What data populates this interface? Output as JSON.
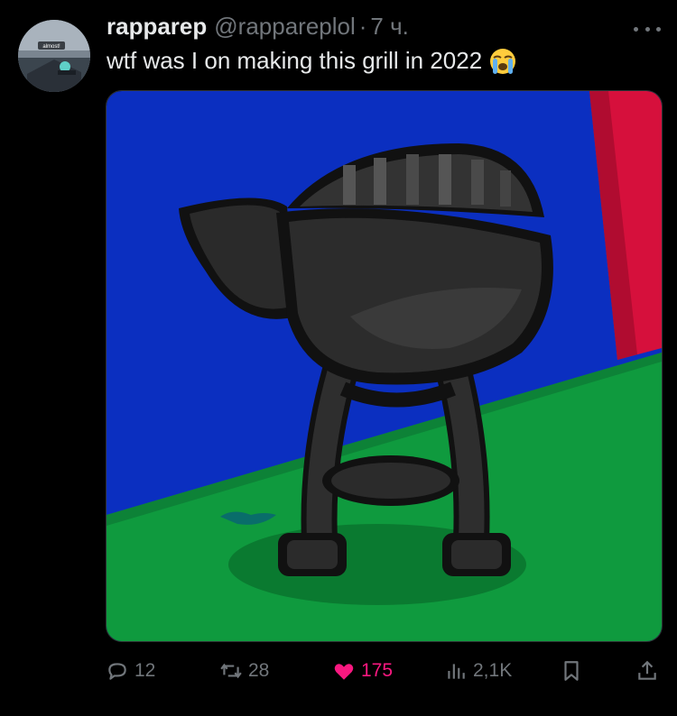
{
  "tweet": {
    "display_name": "rapparep",
    "handle": "@rappareplol",
    "separator": "·",
    "time": "7 ч.",
    "text": "wtf was I on making this grill in 2022",
    "avatar_caption": "almost!",
    "emoji": "loudly-crying-face",
    "media_alt_icons": [
      "grill-image"
    ]
  },
  "actions": {
    "replies": "12",
    "reposts": "28",
    "likes": "175",
    "views": "2,1K"
  },
  "colors": {
    "background": "#000000",
    "text_primary": "#e7e9ea",
    "text_secondary": "#71767b",
    "like": "#f91880"
  },
  "icons": {
    "reply": "reply-icon",
    "repost": "repost-icon",
    "like": "heart-icon",
    "views": "views-icon",
    "bookmark": "bookmark-icon",
    "share": "share-icon",
    "more": "more-icon"
  }
}
